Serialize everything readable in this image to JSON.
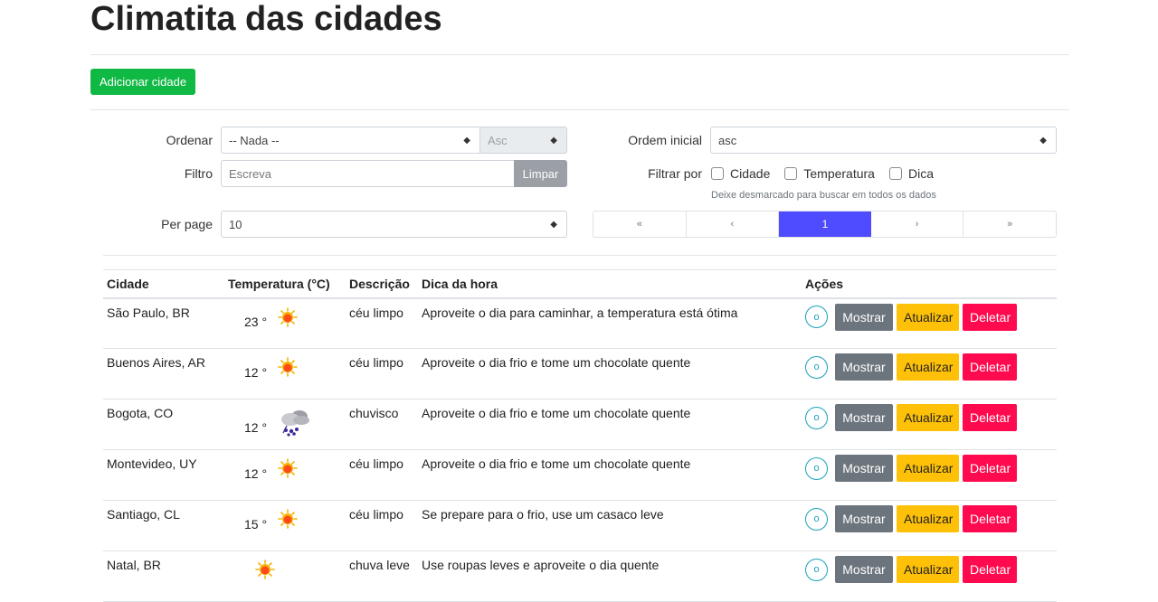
{
  "page": {
    "title": "Climatita das cidades"
  },
  "toolbar": {
    "add_label": "Adicionar cidade"
  },
  "filters": {
    "sort_label": "Ordenar",
    "sort_value": "-- Nada --",
    "sort_dir_value": "Asc",
    "filter_label": "Filtro",
    "filter_placeholder": "Escreva",
    "clear_label": "Limpar",
    "per_page_label": "Per page",
    "per_page_value": "10",
    "initial_order_label": "Ordem inicial",
    "initial_order_value": "asc",
    "filter_by_label": "Filtrar por",
    "filter_by_options": [
      "Cidade",
      "Temperatura",
      "Dica"
    ],
    "filter_hint": "Deixe desmarcado para buscar em todos os dados"
  },
  "pagination": {
    "first": "«",
    "prev": "‹",
    "current": "1",
    "next": "›",
    "last": "»"
  },
  "table": {
    "headers": [
      "Cidade",
      "Temperatura (°C)",
      "Descrição",
      "Dica da hora",
      "Ações"
    ],
    "rows": [
      {
        "city": "São Paulo, BR",
        "temp": "23 °",
        "icon": "sun-icon",
        "desc": "céu limpo",
        "tip": "Aproveite o dia para caminhar, a temperatura está ótima"
      },
      {
        "city": "Buenos Aires, AR",
        "temp": "12 °",
        "icon": "sun-icon",
        "desc": "céu limpo",
        "tip": "Aproveite o dia frio e tome um chocolate quente"
      },
      {
        "city": "Bogota, CO",
        "temp": "12 °",
        "icon": "rain-cloud-icon",
        "desc": "chuvisco",
        "tip": "Aproveite o dia frio e tome um chocolate quente"
      },
      {
        "city": "Montevideo, UY",
        "temp": "12 °",
        "icon": "sun-icon",
        "desc": "céu limpo",
        "tip": "Aproveite o dia frio e tome um chocolate quente"
      },
      {
        "city": "Santiago, CL",
        "temp": "15 °",
        "icon": "sun-icon",
        "desc": "céu limpo",
        "tip": "Se prepare para o frio, use um casaco leve"
      },
      {
        "city": "Natal, BR",
        "temp": "",
        "icon": "sun-icon",
        "desc": "chuva leve",
        "tip": "Use roupas leves e aproveite o dia quente"
      }
    ],
    "actions": {
      "details": "o",
      "show": "Mostrar",
      "update": "Atualizar",
      "delete": "Deletar"
    }
  },
  "colors": {
    "add": "#10b944",
    "show": "#6c757d",
    "update": "#ffc107",
    "delete": "#ff0a4e",
    "page_active": "#4f4bff",
    "details": "#17a2b8"
  }
}
